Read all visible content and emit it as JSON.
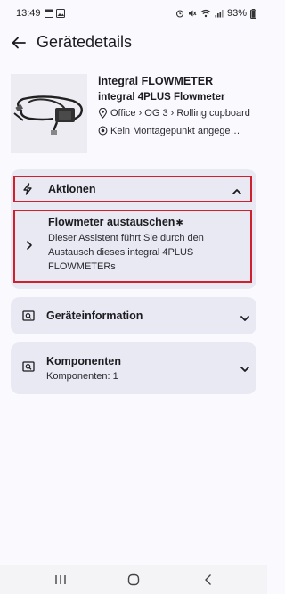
{
  "status_bar": {
    "time": "13:49",
    "left_icons": [
      "calendar-icon",
      "gallery-icon"
    ],
    "right_icons": [
      "alarm-icon",
      "mute-icon",
      "wifi-icon",
      "signal-icon"
    ],
    "battery": "93%"
  },
  "app_bar": {
    "title": "Gerätedetails",
    "back_icon": "arrow-left-icon"
  },
  "device": {
    "name": "integral FLOWMETER",
    "model": "integral 4PLUS Flowmeter",
    "location": "Office › OG 3 › Rolling cupboard",
    "mount_point": "Kein Montagepunkt angege…",
    "icons": {
      "location": "location-pin-icon",
      "mount": "target-icon"
    }
  },
  "actions": {
    "header_label": "Aktionen",
    "header_icon": "lightning-icon",
    "item_title": "Flowmeter austauschen",
    "item_badge": "✱",
    "item_description": "Dieser Assistent führt Sie durch den Austausch dieses integral 4PLUS FLOWMETERs"
  },
  "device_info": {
    "label": "Geräteinformation",
    "icon": "search-card-icon"
  },
  "components": {
    "label": "Komponenten",
    "subtitle": "Komponenten: 1",
    "icon": "search-card-icon"
  },
  "colors": {
    "background": "#f9f9fe",
    "card": "#e9e9f3",
    "highlight_border": "#d0202d",
    "text": "#1c1c20"
  }
}
